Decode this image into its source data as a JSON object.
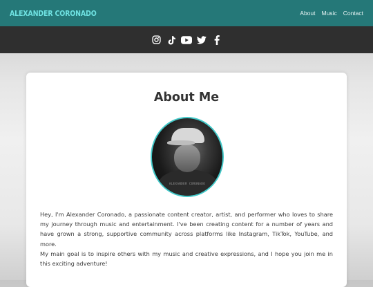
{
  "header": {
    "brand": "ALEXANDER CORONADO",
    "nav": [
      {
        "label": "About"
      },
      {
        "label": "Music"
      },
      {
        "label": "Contact"
      }
    ],
    "colors": {
      "bar": "#257878",
      "brand": "#6fe2e2"
    }
  },
  "social": {
    "icons": [
      "instagram-icon",
      "tiktok-icon",
      "youtube-icon",
      "twitter-icon",
      "facebook-icon"
    ]
  },
  "about": {
    "title": "About Me",
    "avatar_signature": "ALEXANDER CORONADO",
    "paragraph1": "Hey, I'm Alexander Coronado, a passionate content creator, artist, and performer who loves to share my journey through music and entertainment. I've been creating content for a number of years and have grown a strong, supportive community across platforms like Instagram, TikTok, YouTube, and more.",
    "paragraph2": "My main goal is to inspire others with my music and creative expressions, and I hope you join me in this exciting adventure!"
  }
}
